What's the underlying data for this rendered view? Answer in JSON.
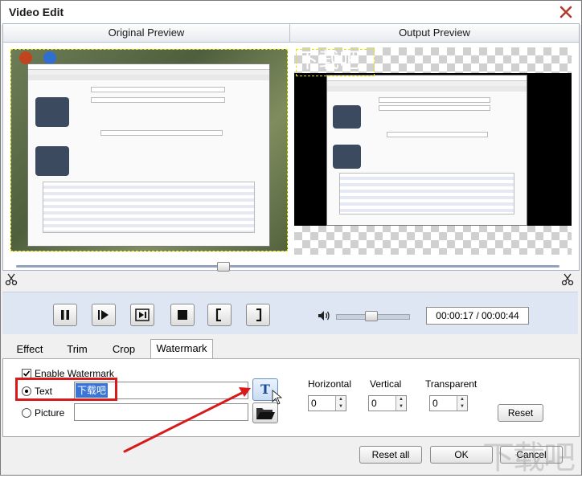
{
  "window": {
    "title": "Video Edit"
  },
  "preview": {
    "original_label": "Original Preview",
    "output_label": "Output Preview"
  },
  "watermark_overlay_text": "下载吧",
  "player": {
    "time_display": "00:00:17 / 00:00:44",
    "timeline_progress": 0.38,
    "volume_level": 0.5
  },
  "tabs": [
    {
      "label": "Effect",
      "active": false
    },
    {
      "label": "Trim",
      "active": false
    },
    {
      "label": "Crop",
      "active": false
    },
    {
      "label": "Watermark",
      "active": true
    }
  ],
  "watermark": {
    "enable_label": "Enable Watermark",
    "enable_checked": true,
    "text_label": "Text",
    "text_value": "下载吧",
    "picture_label": "Picture",
    "picture_value": "",
    "horizontal_label": "Horizontal",
    "horizontal_value": "0",
    "vertical_label": "Vertical",
    "vertical_value": "0",
    "transparent_label": "Transparent",
    "transparent_value": "0",
    "reset_label": "Reset"
  },
  "footer": {
    "reset_all_label": "Reset all",
    "ok_label": "OK",
    "cancel_label": "Cancel"
  },
  "colors": {
    "annotation_red": "#d71a1a",
    "selection_blue": "#3875d7",
    "watermark_dash": "#e6e600"
  },
  "icons": [
    "close-icon",
    "pause-icon",
    "next-frame-icon",
    "play-to-end-icon",
    "stop-icon",
    "mark-in-icon",
    "mark-out-icon",
    "volume-icon",
    "text-t-icon",
    "folder-open-icon",
    "scissor-icon"
  ]
}
